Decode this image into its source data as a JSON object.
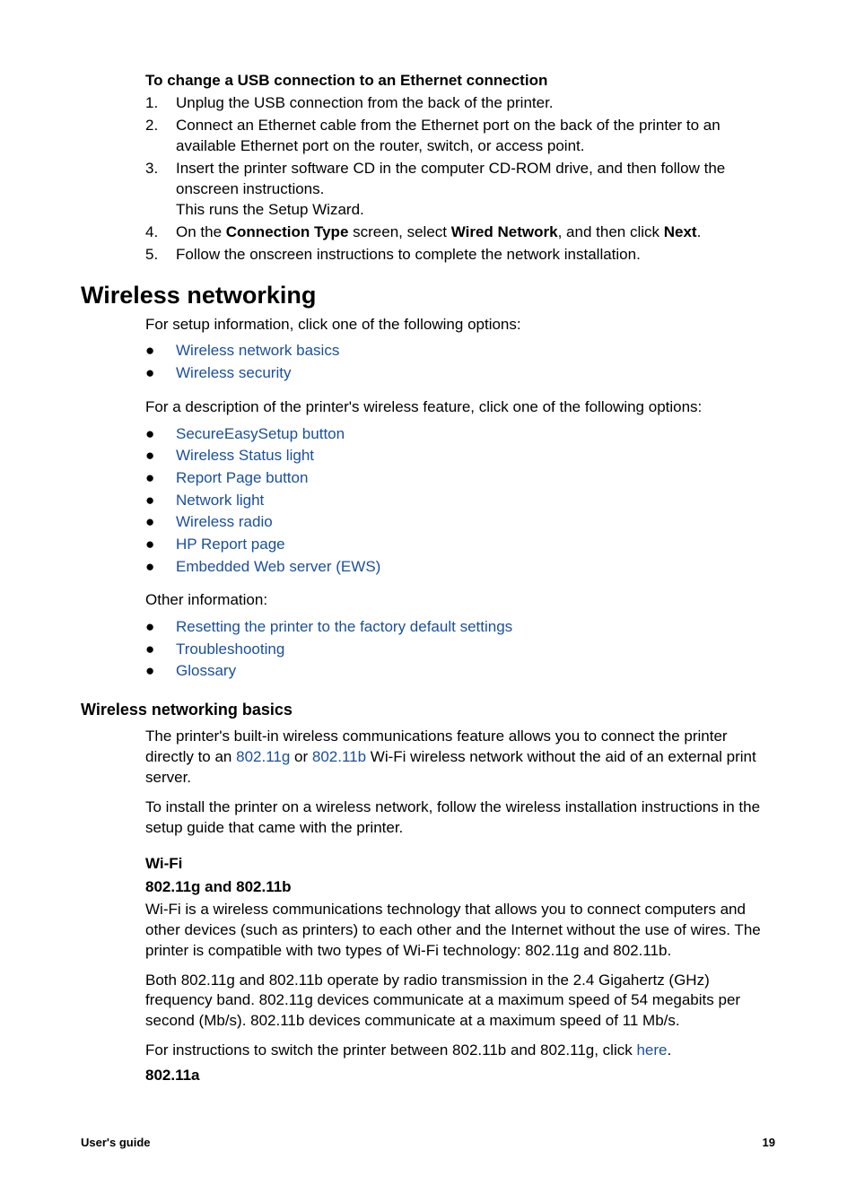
{
  "usb_ethernet": {
    "heading": "To change a USB connection to an Ethernet connection",
    "steps": [
      {
        "num": "1.",
        "text": "Unplug the USB connection from the back of the printer."
      },
      {
        "num": "2.",
        "text": "Connect an Ethernet cable from the Ethernet port on the back of the printer to an available Ethernet port on the router, switch, or access point."
      },
      {
        "num": "3.",
        "text": "Insert the printer software CD in the computer CD-ROM drive, and then follow the onscreen instructions.",
        "extra": "This runs the Setup Wizard."
      },
      {
        "num": "4.",
        "pre": "On the ",
        "b1": "Connection Type",
        "mid": " screen, select ",
        "b2": "Wired Network",
        "mid2": ", and then click ",
        "b3": "Next",
        "post": "."
      },
      {
        "num": "5.",
        "text": "Follow the onscreen instructions to complete the network installation."
      }
    ]
  },
  "wireless": {
    "title": "Wireless networking",
    "intro1": "For setup information, click one of the following options:",
    "setup_links": [
      "Wireless network basics",
      "Wireless security"
    ],
    "intro2": "For a description of the printer's wireless feature, click one of the following options:",
    "feature_links": [
      "SecureEasySetup button",
      "Wireless Status light",
      "Report Page button",
      "Network light",
      "Wireless radio",
      "HP Report page",
      "Embedded Web server (EWS)"
    ],
    "other_label": "Other information:",
    "other_links": [
      "Resetting the printer to the factory default settings",
      "Troubleshooting",
      "Glossary"
    ]
  },
  "basics": {
    "heading": "Wireless networking basics",
    "para1_pre": "The printer's built-in wireless communications feature allows you to connect the printer directly to an ",
    "link1": "802.11g",
    "para1_mid": " or ",
    "link2": "802.11b",
    "para1_post": " Wi-Fi wireless network without the aid of an external print server.",
    "para2": "To install the printer on a wireless network, follow the wireless installation instructions in the setup guide that came with the printer.",
    "wifi_heading": "Wi-Fi",
    "gb_heading": "802.11g and 802.11b",
    "gb_para1": "Wi-Fi is a wireless communications technology that allows you to connect computers and other devices (such as printers) to each other and the Internet without the use of wires. The printer is compatible with two types of Wi-Fi technology: 802.11g and 802.11b.",
    "gb_para2": "Both 802.11g and 802.11b operate by radio transmission in the 2.4 Gigahertz (GHz) frequency band. 802.11g devices communicate at a maximum speed of 54 megabits per second (Mb/s). 802.11b devices communicate at a maximum speed of 11 Mb/s.",
    "gb_para3_pre": "For instructions to switch the printer between 802.11b and 802.11g, click ",
    "gb_para3_link": "here",
    "gb_para3_post": ".",
    "a_heading": "802.11a"
  },
  "footer": {
    "left": "User's guide",
    "right": "19"
  }
}
